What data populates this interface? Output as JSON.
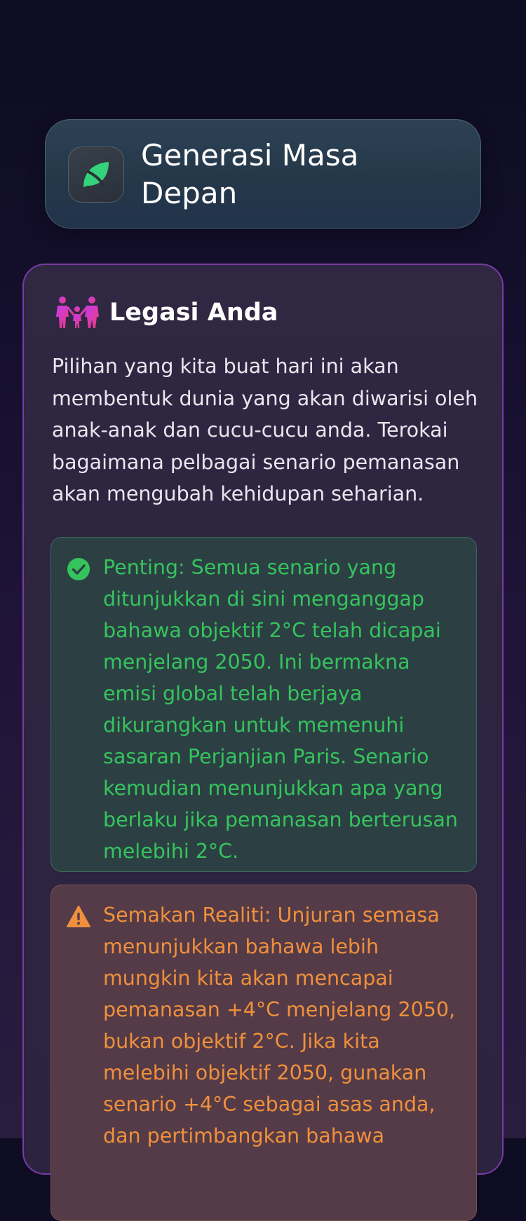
{
  "header": {
    "app_name": "Generasi Masa Depan",
    "icon": "leaf-icon",
    "accent_color": "#34d27b"
  },
  "legacy": {
    "icon": "family-icon",
    "title": "Legasi Anda",
    "description": "Pilihan yang kita buat hari ini akan membentuk dunia yang akan diwarisi oleh anak-anak dan cucu-cucu anda. Terokai bagaimana pelbagai senario pemanasan akan mengubah kehidupan seharian."
  },
  "notes": {
    "important": {
      "icon": "check-circle-icon",
      "color": "#35c45c",
      "text": "Penting: Semua senario yang ditunjukkan di sini menganggap bahawa objektif 2°C telah dicapai menjelang 2050. Ini bermakna emisi global telah berjaya dikurangkan untuk memenuhi sasaran Perjanjian Paris. Senario kemudian menunjukkan apa yang berlaku jika pemanasan berterusan melebihi 2°C."
    },
    "reality": {
      "icon": "warning-triangle-icon",
      "color": "#f0903c",
      "text": "Semakan Realiti: Unjuran semasa menunjukkan bahawa lebih mungkin kita akan mencapai pemanasan +4°C menjelang 2050, bukan objektif 2°C. Jika kita melebihi objektif 2050, gunakan senario +4°C sebagai asas anda, dan pertimbangkan bahawa"
    }
  }
}
